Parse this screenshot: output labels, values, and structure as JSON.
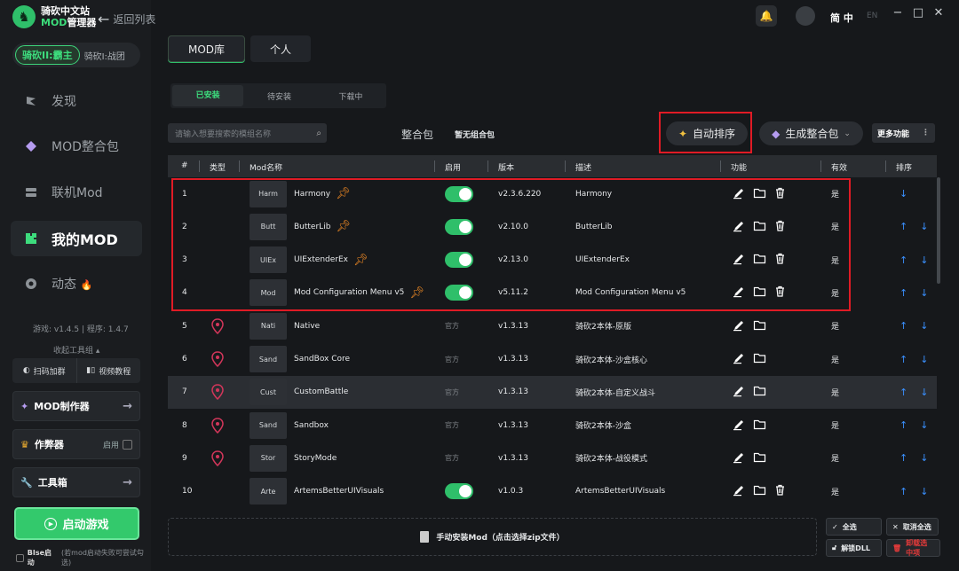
{
  "app": {
    "title_line1": "骑砍中文站",
    "title_line2_brand": "MOD",
    "title_line2_rest": "管理器",
    "back_label": "返回列表"
  },
  "game_switch": {
    "active": "骑砍II:霸主",
    "inactive": "骑砍I:战团"
  },
  "nav": {
    "discover": "发现",
    "modpack": "MOD整合包",
    "online": "联机Mod",
    "mymod": "我的MOD",
    "feed": "动态"
  },
  "version": "游戏: v1.4.5 | 程序: 1.4.7",
  "collapse_tools": "收起工具组 ▴",
  "quick": {
    "join_group": "扫码加群",
    "video": "视频教程"
  },
  "tools": {
    "mod_maker": "MOD制作器",
    "cheat": "作弊器",
    "cheat_enable": "启用",
    "toolbox": "工具箱"
  },
  "start_game": "启动游戏",
  "bse": {
    "label": "BIse启动",
    "note": "(若mod启动失败可尝试勾选)"
  },
  "header": {
    "lang": "简 中",
    "lang_en": "EN"
  },
  "tabs_main": [
    "MOD库",
    "个人"
  ],
  "tabs_sub": [
    "已安装",
    "待安装",
    "下载中"
  ],
  "search": {
    "placeholder": "请输入想要搜索的模组名称"
  },
  "pack": {
    "label": "整合包",
    "value": "暂无组合包"
  },
  "buttons": {
    "auto_sort": "自动排序",
    "gen_pack": "生成整合包",
    "more": "更多功能"
  },
  "columns": {
    "num": "#",
    "type": "类型",
    "name": "Mod名称",
    "enabled": "启用",
    "version": "版本",
    "desc": "描述",
    "func": "功能",
    "valid": "有效",
    "sort": "排序"
  },
  "rows": [
    {
      "num": "1",
      "thumb": "Harm",
      "name": "Harmony",
      "enabled": true,
      "version": "v2.3.6.220",
      "desc": "Harmony",
      "valid": "是",
      "pinned": true,
      "official": false,
      "deletable": true,
      "up": false
    },
    {
      "num": "2",
      "thumb": "Butt",
      "name": "ButterLib",
      "enabled": true,
      "version": "v2.10.0",
      "desc": "ButterLib",
      "valid": "是",
      "pinned": true,
      "official": false,
      "deletable": true,
      "up": true
    },
    {
      "num": "3",
      "thumb": "UIEx",
      "name": "UIExtenderEx",
      "enabled": true,
      "version": "v2.13.0",
      "desc": "UIExtenderEx",
      "valid": "是",
      "pinned": true,
      "official": false,
      "deletable": true,
      "up": true
    },
    {
      "num": "4",
      "thumb": "Mod",
      "name": "Mod Configuration Menu v5",
      "enabled": true,
      "version": "v5.11.2",
      "desc": "Mod Configuration Menu v5",
      "valid": "是",
      "pinned": true,
      "official": false,
      "deletable": true,
      "up": true
    },
    {
      "num": "5",
      "thumb": "Nati",
      "name": "Native",
      "enabled": false,
      "official_label": "官方",
      "version": "v1.3.13",
      "desc": "骑砍2本体-原版",
      "valid": "是",
      "pinned": false,
      "official": true,
      "deletable": false,
      "up": true
    },
    {
      "num": "6",
      "thumb": "Sand",
      "name": "SandBox Core",
      "enabled": false,
      "official_label": "官方",
      "version": "v1.3.13",
      "desc": "骑砍2本体-沙盒核心",
      "valid": "是",
      "pinned": false,
      "official": true,
      "deletable": false,
      "up": true
    },
    {
      "num": "7",
      "thumb": "Cust",
      "name": "CustomBattle",
      "enabled": false,
      "official_label": "官方",
      "version": "v1.3.13",
      "desc": "骑砍2本体-自定义战斗",
      "valid": "是",
      "pinned": false,
      "official": true,
      "deletable": false,
      "up": true
    },
    {
      "num": "8",
      "thumb": "Sand",
      "name": "Sandbox",
      "enabled": false,
      "official_label": "官方",
      "version": "v1.3.13",
      "desc": "骑砍2本体-沙盒",
      "valid": "是",
      "pinned": false,
      "official": true,
      "deletable": false,
      "up": true
    },
    {
      "num": "9",
      "thumb": "Stor",
      "name": "StoryMode",
      "enabled": false,
      "official_label": "官方",
      "version": "v1.3.13",
      "desc": "骑砍2本体-战役模式",
      "valid": "是",
      "pinned": false,
      "official": true,
      "deletable": false,
      "up": true
    },
    {
      "num": "10",
      "thumb": "Arte",
      "name": "ArtemsBetterUIVisuals",
      "enabled": true,
      "version": "v1.0.3",
      "desc": "ArtemsBetterUIVisuals",
      "valid": "是",
      "pinned": false,
      "official": false,
      "deletable": true,
      "up": true
    }
  ],
  "install_label": "手动安装Mod（点击选择zip文件）",
  "bottom_buttons": {
    "select_all": "全选",
    "cancel_all": "取消全选",
    "unlock_dll": "解锁DLL",
    "uninstall": "卸载选中项"
  },
  "colors": {
    "accent": "#2fbf6a",
    "highlight_box": "#e01b25",
    "sort_arrow": "#3a90ff"
  }
}
